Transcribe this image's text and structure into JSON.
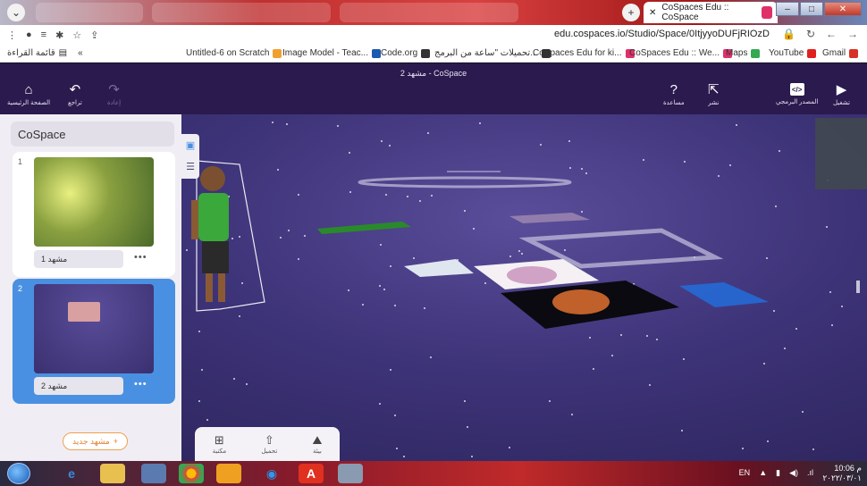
{
  "browser": {
    "active_tab_title": "CoSpaces Edu :: CoSpace",
    "url": "edu.cospaces.io/Studio/Space/0ItjyyoDUFjRIOzD",
    "reading_list_label": "قائمة القراءة",
    "bookmarks": [
      {
        "label": "Untitled-6 on Scratch",
        "color": "#f0a030"
      },
      {
        "label": "Image Model - Teac...",
        "color": "#1a5ab0"
      },
      {
        "label": "Code.org",
        "color": "#333333"
      },
      {
        "label": "تحميلات \"ساعة من البرمج...",
        "color": "#333333"
      },
      {
        "label": "CoSpaces Edu for ki...",
        "color": "#e0306a"
      },
      {
        "label": "CoSpaces Edu :: We...",
        "color": "#e0306a"
      },
      {
        "label": "Maps",
        "color": "#34a853"
      },
      {
        "label": "YouTube",
        "color": "#e02020"
      },
      {
        "label": "Gmail",
        "color": "#d93025"
      }
    ]
  },
  "app": {
    "scene_title": "مشهد 2 - CoSpace",
    "header_left": [
      {
        "label": "الصفحة الرئيسية",
        "icon": "home-icon"
      },
      {
        "label": "تراجع",
        "icon": "undo-icon"
      },
      {
        "label": "إعادة",
        "icon": "redo-icon"
      }
    ],
    "header_right": [
      {
        "label": "مساعدة",
        "icon": "help-icon"
      },
      {
        "label": "نشر",
        "icon": "share-icon"
      },
      {
        "label": "المصدر البرمجي",
        "icon": "code-icon"
      },
      {
        "label": "تشغيل",
        "icon": "play-icon"
      }
    ]
  },
  "sidebar": {
    "title": "CoSpace",
    "scenes": [
      {
        "number": "1",
        "name": "مشهد 1",
        "selected": false
      },
      {
        "number": "2",
        "name": "مشهد 2",
        "selected": true
      }
    ],
    "new_scene_label": "مشهد جديد"
  },
  "bottom_toolbar": [
    {
      "label": "مكتبة",
      "icon": "library-icon"
    },
    {
      "label": "تحميل",
      "icon": "upload-icon"
    },
    {
      "label": "بيئة",
      "icon": "environment-icon"
    }
  ],
  "taskbar": {
    "language": "EN",
    "time": "10:06 م",
    "date": "٢٠٢٢/٠٣/٠١"
  },
  "colors": {
    "header_bg": "#2a1a4e",
    "selected_scene": "#4a90e2",
    "new_scene_accent": "#e08030"
  }
}
